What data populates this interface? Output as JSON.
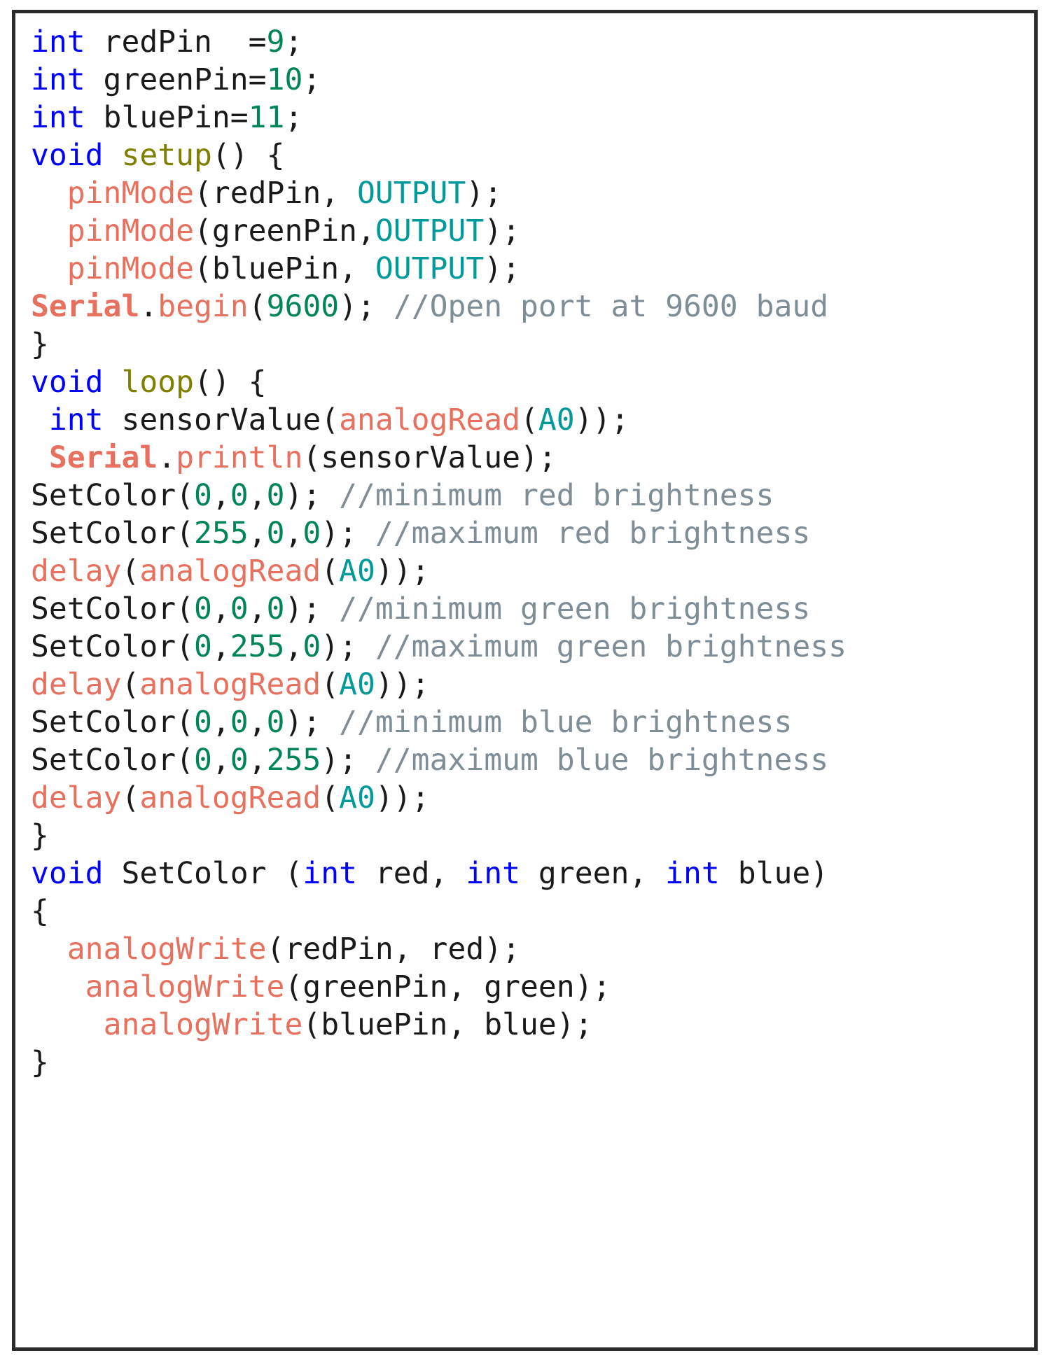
{
  "editor": {
    "language": "arduino-c",
    "border_color": "#2b2b2b",
    "background": "#ffffff",
    "palette": {
      "keyword": "#0000ff",
      "function_def": "#808000",
      "builtin": "#e8705f",
      "constant": "#009a9a",
      "number": "#00855a",
      "comment": "#7f8e96",
      "plain": "#1a1a1a"
    }
  },
  "code": {
    "lines": [
      {
        "id": "line-1",
        "tokens": [
          {
            "t": "int",
            "c": "kw"
          },
          {
            "t": " redPin  =",
            "c": "pl"
          },
          {
            "t": "9",
            "c": "nu"
          },
          {
            "t": ";",
            "c": "pl"
          }
        ]
      },
      {
        "id": "line-2",
        "tokens": [
          {
            "t": "int",
            "c": "kw"
          },
          {
            "t": " greenPin=",
            "c": "pl"
          },
          {
            "t": "10",
            "c": "nu"
          },
          {
            "t": ";",
            "c": "pl"
          }
        ]
      },
      {
        "id": "line-3",
        "tokens": [
          {
            "t": "int",
            "c": "kw"
          },
          {
            "t": " bluePin=",
            "c": "pl"
          },
          {
            "t": "11",
            "c": "nu"
          },
          {
            "t": ";",
            "c": "pl"
          }
        ]
      },
      {
        "id": "line-4",
        "tokens": [
          {
            "t": "void",
            "c": "kw"
          },
          {
            "t": " ",
            "c": "pl"
          },
          {
            "t": "setup",
            "c": "fn"
          },
          {
            "t": "() {",
            "c": "pl"
          }
        ]
      },
      {
        "id": "line-5",
        "tokens": [
          {
            "t": "  ",
            "c": "pl"
          },
          {
            "t": "pinMode",
            "c": "bi"
          },
          {
            "t": "(redPin, ",
            "c": "pl"
          },
          {
            "t": "OUTPUT",
            "c": "cn"
          },
          {
            "t": ");",
            "c": "pl"
          }
        ]
      },
      {
        "id": "line-6",
        "tokens": [
          {
            "t": "  ",
            "c": "pl"
          },
          {
            "t": "pinMode",
            "c": "bi"
          },
          {
            "t": "(greenPin,",
            "c": "pl"
          },
          {
            "t": "OUTPUT",
            "c": "cn"
          },
          {
            "t": ");",
            "c": "pl"
          }
        ]
      },
      {
        "id": "line-7",
        "tokens": [
          {
            "t": "  ",
            "c": "pl"
          },
          {
            "t": "pinMode",
            "c": "bi"
          },
          {
            "t": "(bluePin, ",
            "c": "pl"
          },
          {
            "t": "OUTPUT",
            "c": "cn"
          },
          {
            "t": ");",
            "c": "pl"
          }
        ]
      },
      {
        "id": "line-8",
        "tokens": [
          {
            "t": "Serial",
            "c": "bib"
          },
          {
            "t": ".",
            "c": "pl"
          },
          {
            "t": "begin",
            "c": "bi"
          },
          {
            "t": "(",
            "c": "pl"
          },
          {
            "t": "9600",
            "c": "nu"
          },
          {
            "t": "); ",
            "c": "pl"
          },
          {
            "t": "//Open port at 9600 baud",
            "c": "cm"
          }
        ]
      },
      {
        "id": "line-9",
        "tokens": [
          {
            "t": "}",
            "c": "pl"
          }
        ]
      },
      {
        "id": "line-10",
        "tokens": [
          {
            "t": "void",
            "c": "kw"
          },
          {
            "t": " ",
            "c": "pl"
          },
          {
            "t": "loop",
            "c": "fn"
          },
          {
            "t": "() {",
            "c": "pl"
          }
        ]
      },
      {
        "id": "line-11",
        "tokens": [
          {
            "t": " ",
            "c": "pl"
          },
          {
            "t": "int",
            "c": "kw"
          },
          {
            "t": " sensorValue(",
            "c": "pl"
          },
          {
            "t": "analogRead",
            "c": "bi"
          },
          {
            "t": "(",
            "c": "pl"
          },
          {
            "t": "A0",
            "c": "cn"
          },
          {
            "t": "));",
            "c": "pl"
          }
        ]
      },
      {
        "id": "line-12",
        "tokens": [
          {
            "t": " ",
            "c": "pl"
          },
          {
            "t": "Serial",
            "c": "bib"
          },
          {
            "t": ".",
            "c": "pl"
          },
          {
            "t": "println",
            "c": "bi"
          },
          {
            "t": "(sensorValue);",
            "c": "pl"
          }
        ]
      },
      {
        "id": "line-13",
        "tokens": [
          {
            "t": "SetColor(",
            "c": "pl"
          },
          {
            "t": "0",
            "c": "nu"
          },
          {
            "t": ",",
            "c": "pl"
          },
          {
            "t": "0",
            "c": "nu"
          },
          {
            "t": ",",
            "c": "pl"
          },
          {
            "t": "0",
            "c": "nu"
          },
          {
            "t": "); ",
            "c": "pl"
          },
          {
            "t": "//minimum red brightness",
            "c": "cm"
          }
        ]
      },
      {
        "id": "line-14",
        "tokens": [
          {
            "t": "SetColor(",
            "c": "pl"
          },
          {
            "t": "255",
            "c": "nu"
          },
          {
            "t": ",",
            "c": "pl"
          },
          {
            "t": "0",
            "c": "nu"
          },
          {
            "t": ",",
            "c": "pl"
          },
          {
            "t": "0",
            "c": "nu"
          },
          {
            "t": "); ",
            "c": "pl"
          },
          {
            "t": "//maximum red brightness",
            "c": "cm"
          }
        ]
      },
      {
        "id": "line-15",
        "tokens": [
          {
            "t": "delay",
            "c": "bi"
          },
          {
            "t": "(",
            "c": "pl"
          },
          {
            "t": "analogRead",
            "c": "bi"
          },
          {
            "t": "(",
            "c": "pl"
          },
          {
            "t": "A0",
            "c": "cn"
          },
          {
            "t": "));",
            "c": "pl"
          }
        ]
      },
      {
        "id": "line-16",
        "tokens": [
          {
            "t": "SetColor(",
            "c": "pl"
          },
          {
            "t": "0",
            "c": "nu"
          },
          {
            "t": ",",
            "c": "pl"
          },
          {
            "t": "0",
            "c": "nu"
          },
          {
            "t": ",",
            "c": "pl"
          },
          {
            "t": "0",
            "c": "nu"
          },
          {
            "t": "); ",
            "c": "pl"
          },
          {
            "t": "//minimum green brightness",
            "c": "cm"
          }
        ]
      },
      {
        "id": "line-17",
        "tokens": [
          {
            "t": "SetColor(",
            "c": "pl"
          },
          {
            "t": "0",
            "c": "nu"
          },
          {
            "t": ",",
            "c": "pl"
          },
          {
            "t": "255",
            "c": "nu"
          },
          {
            "t": ",",
            "c": "pl"
          },
          {
            "t": "0",
            "c": "nu"
          },
          {
            "t": "); ",
            "c": "pl"
          },
          {
            "t": "//maximum green brightness",
            "c": "cm"
          }
        ]
      },
      {
        "id": "line-18",
        "tokens": [
          {
            "t": "delay",
            "c": "bi"
          },
          {
            "t": "(",
            "c": "pl"
          },
          {
            "t": "analogRead",
            "c": "bi"
          },
          {
            "t": "(",
            "c": "pl"
          },
          {
            "t": "A0",
            "c": "cn"
          },
          {
            "t": "));",
            "c": "pl"
          }
        ]
      },
      {
        "id": "line-19",
        "tokens": [
          {
            "t": "SetColor(",
            "c": "pl"
          },
          {
            "t": "0",
            "c": "nu"
          },
          {
            "t": ",",
            "c": "pl"
          },
          {
            "t": "0",
            "c": "nu"
          },
          {
            "t": ",",
            "c": "pl"
          },
          {
            "t": "0",
            "c": "nu"
          },
          {
            "t": "); ",
            "c": "pl"
          },
          {
            "t": "//minimum blue brightness",
            "c": "cm"
          }
        ]
      },
      {
        "id": "line-20",
        "tokens": [
          {
            "t": "SetColor(",
            "c": "pl"
          },
          {
            "t": "0",
            "c": "nu"
          },
          {
            "t": ",",
            "c": "pl"
          },
          {
            "t": "0",
            "c": "nu"
          },
          {
            "t": ",",
            "c": "pl"
          },
          {
            "t": "255",
            "c": "nu"
          },
          {
            "t": "); ",
            "c": "pl"
          },
          {
            "t": "//maximum blue brightness",
            "c": "cm"
          }
        ]
      },
      {
        "id": "line-21",
        "tokens": [
          {
            "t": "delay",
            "c": "bi"
          },
          {
            "t": "(",
            "c": "pl"
          },
          {
            "t": "analogRead",
            "c": "bi"
          },
          {
            "t": "(",
            "c": "pl"
          },
          {
            "t": "A0",
            "c": "cn"
          },
          {
            "t": "));",
            "c": "pl"
          }
        ]
      },
      {
        "id": "line-22",
        "tokens": [
          {
            "t": "}",
            "c": "pl"
          }
        ]
      },
      {
        "id": "line-23",
        "tokens": [
          {
            "t": "void",
            "c": "kw"
          },
          {
            "t": " SetColor (",
            "c": "pl"
          },
          {
            "t": "int",
            "c": "kw"
          },
          {
            "t": " red, ",
            "c": "pl"
          },
          {
            "t": "int",
            "c": "kw"
          },
          {
            "t": " green, ",
            "c": "pl"
          },
          {
            "t": "int",
            "c": "kw"
          },
          {
            "t": " blue)",
            "c": "pl"
          }
        ]
      },
      {
        "id": "line-24",
        "tokens": [
          {
            "t": "{",
            "c": "pl"
          }
        ]
      },
      {
        "id": "line-25",
        "tokens": [
          {
            "t": "  ",
            "c": "pl"
          },
          {
            "t": "analogWrite",
            "c": "bi"
          },
          {
            "t": "(redPin, red);",
            "c": "pl"
          }
        ]
      },
      {
        "id": "line-26",
        "tokens": [
          {
            "t": "   ",
            "c": "pl"
          },
          {
            "t": "analogWrite",
            "c": "bi"
          },
          {
            "t": "(greenPin, green);",
            "c": "pl"
          }
        ]
      },
      {
        "id": "line-27",
        "tokens": [
          {
            "t": "    ",
            "c": "pl"
          },
          {
            "t": "analogWrite",
            "c": "bi"
          },
          {
            "t": "(bluePin, blue);",
            "c": "pl"
          }
        ]
      },
      {
        "id": "line-28",
        "tokens": [
          {
            "t": "}",
            "c": "pl"
          }
        ]
      }
    ]
  }
}
